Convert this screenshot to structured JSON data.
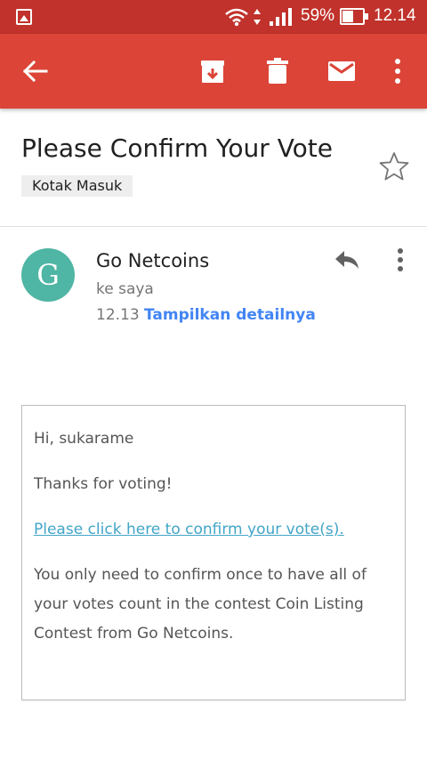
{
  "status_bar": {
    "battery_percent": "59%",
    "time": "12.14"
  },
  "toolbar": {
    "icons": [
      "back-arrow-icon",
      "archive-icon",
      "delete-icon",
      "mail-icon",
      "more-vert-icon"
    ],
    "background": "#db4437"
  },
  "email": {
    "subject": "Please Confirm Your Vote",
    "label": "Kotak Masuk",
    "sender": {
      "avatar_letter": "G",
      "avatar_color": "#4fb5a4",
      "name": "Go Netcoins",
      "recipient": "ke saya",
      "time": "12.13",
      "details_link": "Tampilkan detailnya"
    },
    "body": {
      "greeting": "Hi, sukarame",
      "thanks": "Thanks for voting!",
      "confirm_link": "Please click here to confirm your vote(s).",
      "line1": "You only need to confirm once to have all of",
      "line2": "your votes count in the contest Coin Listing",
      "line3": "Contest from Go Netcoins."
    }
  }
}
